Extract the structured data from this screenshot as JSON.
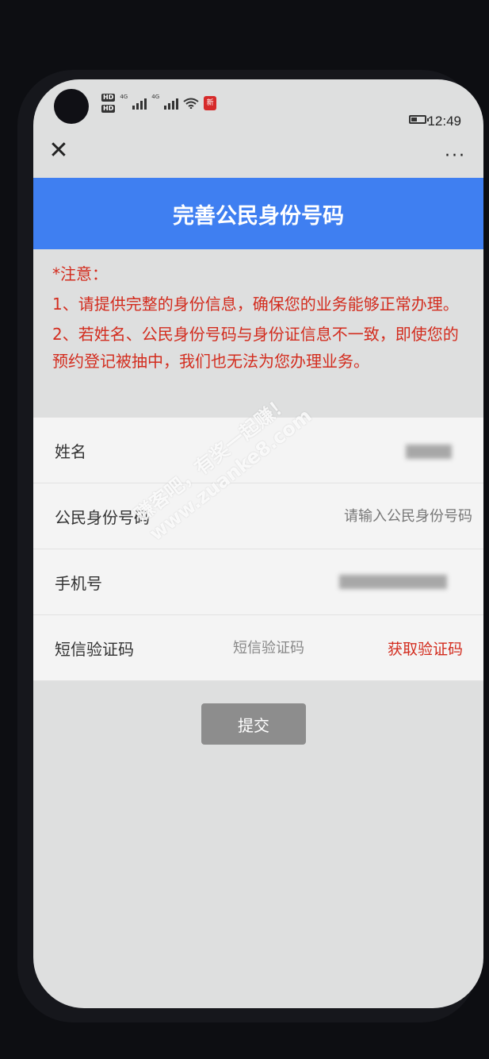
{
  "status_bar": {
    "hd1": "HD",
    "hd2": "HD",
    "net1": "4G",
    "net2": "4G",
    "app_badge": "新",
    "time": "12:49"
  },
  "nav": {
    "close_symbol": "✕",
    "more_symbol": "···"
  },
  "header": {
    "title": "完善公民身份号码"
  },
  "notice": {
    "heading": "*注意：",
    "item1": "1、请提供完整的身份信息，确保您的业务能够正常办理。",
    "item2": "2、若姓名、公民身份号码与身份证信息不一致，即使您的预约登记被抽中，我们也无法为您办理业务。"
  },
  "form": {
    "name_label": "姓名",
    "id_label": "公民身份号码",
    "id_placeholder": "请输入公民身份号码",
    "phone_label": "手机号",
    "sms_label": "短信验证码",
    "sms_placeholder": "短信验证码",
    "get_code_label": "获取验证码"
  },
  "submit": {
    "label": "提交"
  },
  "watermark": {
    "line1": "赚客吧，有奖一起赚！",
    "line2": "www.zuanke8.com"
  },
  "colors": {
    "header_blue": "#3f7ff1",
    "notice_red": "#d32c1e",
    "button_gray": "#8d8d8d"
  }
}
